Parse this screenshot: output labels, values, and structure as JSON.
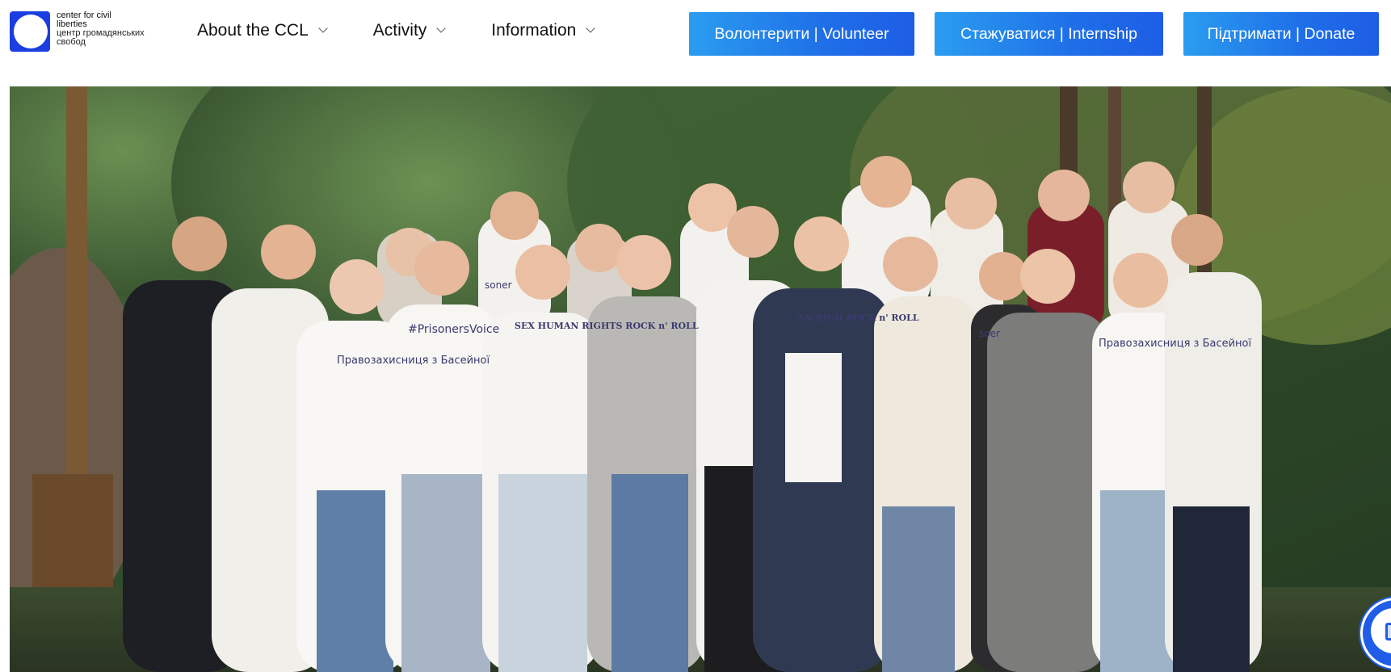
{
  "header": {
    "logo": {
      "line_en_1": "center for civil",
      "line_en_2": "liberties",
      "line_ua_1": "центр громадянських",
      "line_ua_2": "свобод",
      "brand_color": "#1a3ee0"
    },
    "nav": [
      {
        "label": "About the CCL",
        "icon": "chevron-down-icon"
      },
      {
        "label": "Activity",
        "icon": "chevron-down-icon"
      },
      {
        "label": "Information",
        "icon": "chevron-down-icon"
      }
    ],
    "cta": {
      "volunteer": "Волонтерити | Volunteer",
      "internship": "Стажуватися | Internship",
      "donate": "Підтримати | Donate",
      "accent": "#1f6fe8"
    }
  },
  "hero": {
    "t_shirt_texts": [
      "Правозахисниця з Басейної",
      "#PrisonersVoice",
      "SEX HUMAN RIGHTS ROCK n' ROLL",
      "AN RIGH ROCK n' ROLL",
      "soner",
      "soer",
      "Правозахисниця з Басейної"
    ]
  },
  "chat_widget": {
    "icon": "chat-icon"
  }
}
